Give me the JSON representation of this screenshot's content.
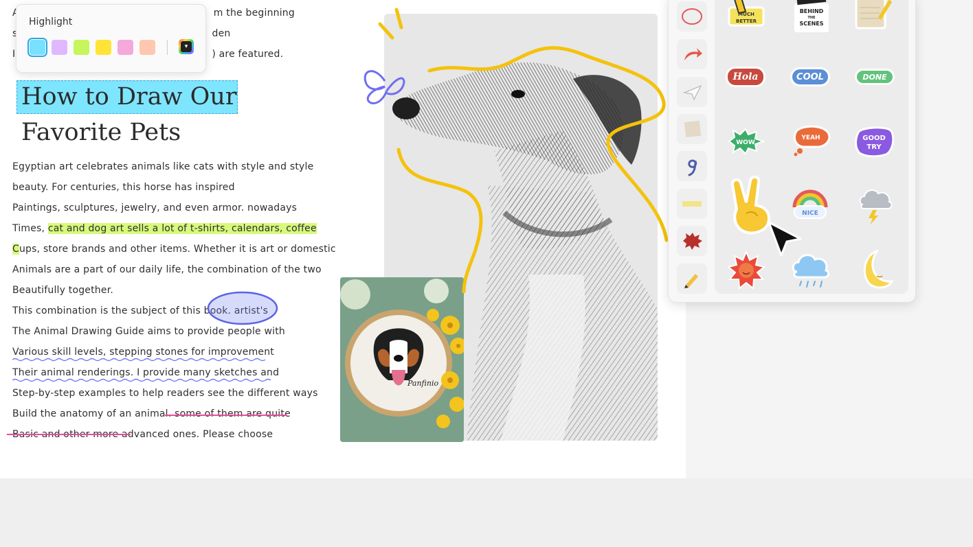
{
  "colors": {
    "accent_highlight": "#7ee5ff",
    "text_highlight": "#d7f97c",
    "wavy_underline": "#6f7bf5",
    "strike": "#e64d9b",
    "doodle": "#f4c20d"
  },
  "highlight_popup": {
    "label": "Highlight",
    "swatches": [
      "cyan",
      "lavender",
      "lime",
      "yellow",
      "pink",
      "peach"
    ]
  },
  "document": {
    "top_lines": [
      {
        "prefix": "A",
        "suffix": "m the beginning"
      },
      {
        "prefix": "s",
        "suffix": "den"
      },
      {
        "prefix": "I",
        "suffix": ") are featured."
      }
    ],
    "title_line1": "How to Draw Our",
    "title_line2": "Favorite Pets",
    "body": {
      "l1": "Egyptian art celebrates animals like cats with style and style",
      "l2": "beauty. For centuries, this horse has inspired",
      "l3": "Paintings, sculptures, jewelry, and even armor. nowadays",
      "l4a": "Times, ",
      "l4b": "cat and dog art sells a lot of t-shirts, calendars, coffee",
      "l5a": "C",
      "l5b": "ups, store brands and other items. Whether it is art or domestic",
      "l6": "Animals are a part of our daily life, the combination of the two",
      "l7": "Beautifully together.",
      "l8": "This combination is the subject of this book. artist's",
      "l9": "The Animal Drawing Guide aims to provide people with",
      "l10": "Various skill levels, stepping stones for improvement",
      "l11": "Their animal renderings. I provide many sketches and",
      "l12": "Step-by-step examples to help readers see the different ways",
      "l13a": "Build the anatomy of an animal.",
      "l13b": " some of them are quite",
      "l14a": "Basic and other more ad",
      "l14b": "vanced ones. Please choose"
    }
  },
  "hoop_signature": "Panfinio",
  "sticker_panel": {
    "categories": [
      "circle-icon",
      "arrow-icon",
      "paper-plane-icon",
      "note-icon",
      "number-nine-icon",
      "tape-icon",
      "comic-burst-icon",
      "pencil-icon"
    ],
    "stickers": [
      "MUCH BETTER",
      "BEHIND THE SCENES",
      "NOTEPAD",
      "Hola",
      "COOL",
      "DONE",
      "WOW",
      "YEAH",
      "GOOD TRY",
      "PEACE",
      "NICE",
      "STORM",
      "SUN",
      "RAIN",
      "MOON"
    ],
    "sticker_text": {
      "behind": "BEHIND",
      "the": "THE",
      "scenes": "SCENES",
      "hola": "Hola",
      "cool": "COOL",
      "done": "DONE",
      "wow": "WOW",
      "yeah": "YEAH",
      "good": "GOOD",
      "try": "TRY",
      "nice": "NICE",
      "much": "MUCH",
      "better": "BETTER"
    }
  }
}
